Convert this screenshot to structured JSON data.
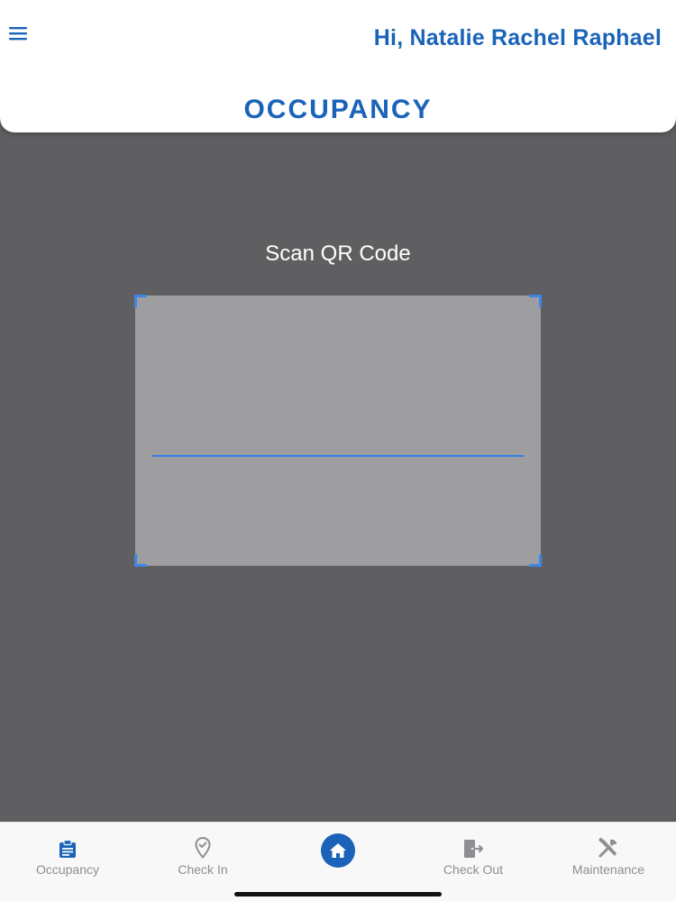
{
  "header": {
    "greeting": "Hi, Natalie Rachel Raphael",
    "title": "OCCUPANCY",
    "menu_icon": "hamburger-menu-icon"
  },
  "scanner": {
    "label": "Scan QR Code"
  },
  "bottom_nav": {
    "items": [
      {
        "label": "Occupancy",
        "icon": "clipboard-icon",
        "active": true
      },
      {
        "label": "Check In",
        "icon": "map-pin-check-icon",
        "active": false
      },
      {
        "label": "",
        "icon": "home-icon",
        "active": false
      },
      {
        "label": "Check Out",
        "icon": "door-exit-icon",
        "active": false
      },
      {
        "label": "Maintenance",
        "icon": "tools-icon",
        "active": false
      }
    ]
  },
  "colors": {
    "brand_blue": "#1a63b8",
    "background": "#5f5e61",
    "scanner_fill": "#9e9da0",
    "scan_line": "#2f7fe6",
    "inactive_nav": "#8e8e93"
  }
}
